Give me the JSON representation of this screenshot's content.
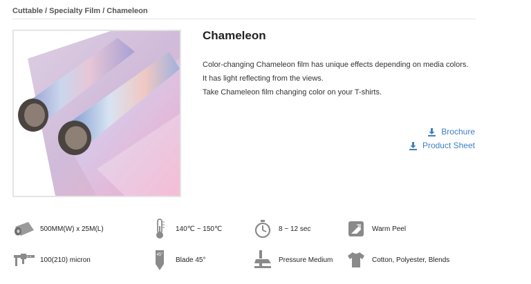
{
  "breadcrumb": "Cuttable / Specialty Film / Chameleon",
  "product": {
    "title": "Chameleon",
    "description": [
      "Color-changing Chameleon film has unique effects depending on media colors.",
      "It has light reflecting from the views.",
      "Take Chameleon film changing color on your T-shirts."
    ]
  },
  "downloads": [
    {
      "label": "Brochure",
      "icon": "download-icon"
    },
    {
      "label": "Product Sheet",
      "icon": "download-icon"
    }
  ],
  "specs": [
    {
      "icon": "roll-icon",
      "text": "500MM(W) x 25M(L)"
    },
    {
      "icon": "thermometer-icon",
      "text": "140℃ ~ 150℃"
    },
    {
      "icon": "stopwatch-icon",
      "text": "8 ~ 12 sec"
    },
    {
      "icon": "warm-peel-icon",
      "text": "Warm Peel"
    },
    {
      "icon": "caliper-icon",
      "text": "100(210) micron"
    },
    {
      "icon": "blade-icon",
      "text": "Blade 45°"
    },
    {
      "icon": "press-icon",
      "text": "Pressure Medium"
    },
    {
      "icon": "tshirt-icon",
      "text": "Cotton, Polyester, Blends"
    }
  ],
  "colors": {
    "link": "#3d7fc0",
    "icon": "#888888"
  }
}
